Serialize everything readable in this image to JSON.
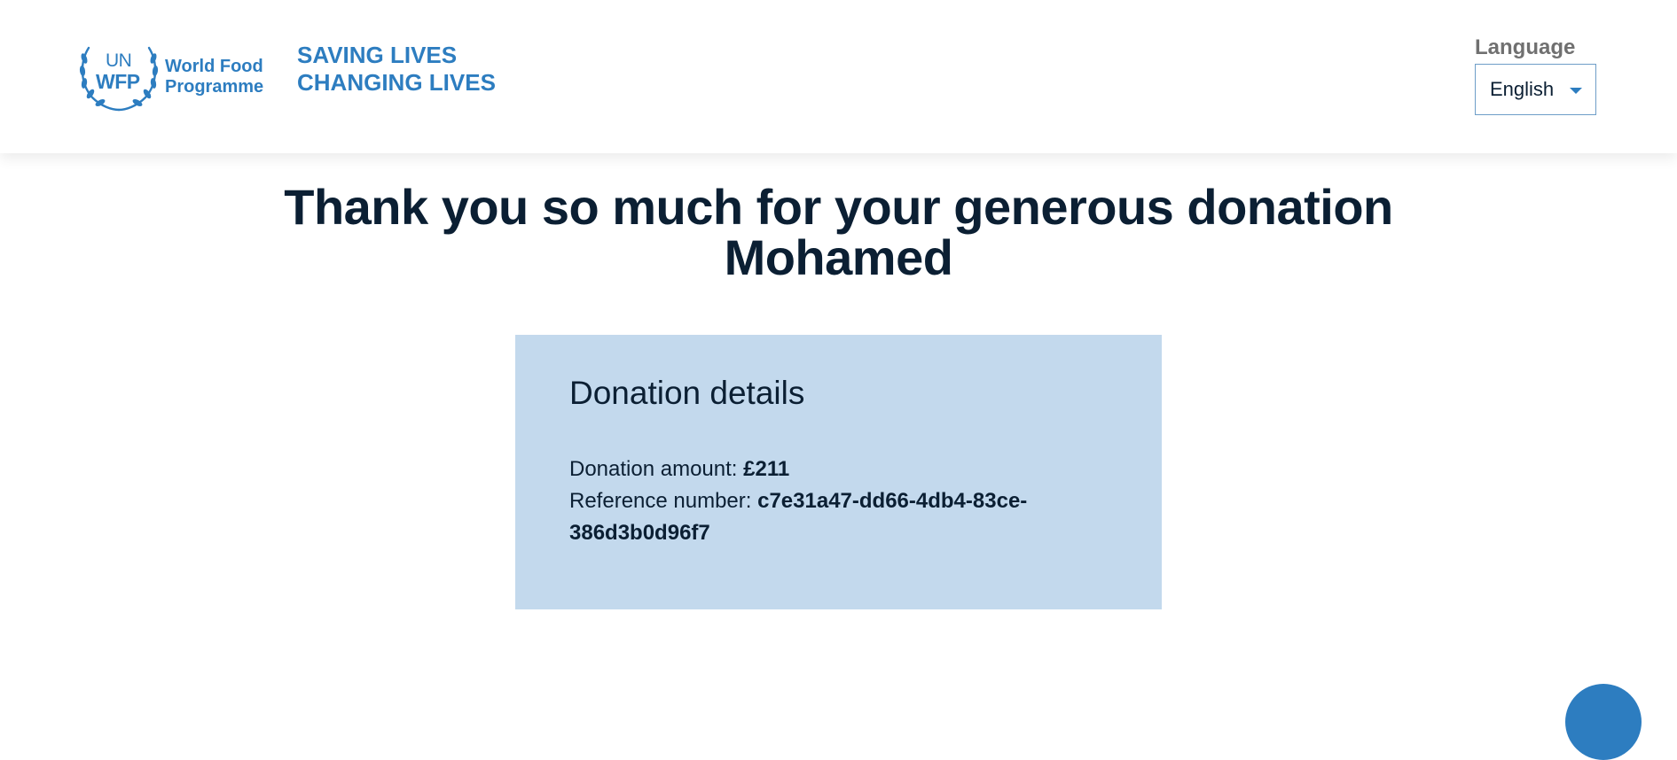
{
  "header": {
    "logo": {
      "un": "UN",
      "wfp": "WFP",
      "name_line1": "World Food",
      "name_line2": "Programme"
    },
    "tagline_line1": "SAVING LIVES",
    "tagline_line2": "CHANGING LIVES",
    "language": {
      "label": "Language",
      "selected": "English"
    }
  },
  "main": {
    "heading_line1": "Thank you so much for your generous donation",
    "heading_line2": "Mohamed",
    "details": {
      "title": "Donation details",
      "amount_label": "Donation amount: ",
      "amount_value": "£211",
      "reference_label": "Reference number: ",
      "reference_value": "c7e31a47-dd66-4db4-83ce-386d3b0d96f7"
    }
  },
  "colors": {
    "brand_blue": "#2d7dc0",
    "text_dark": "#0b1f33",
    "card_background": "#c3d9ed"
  }
}
